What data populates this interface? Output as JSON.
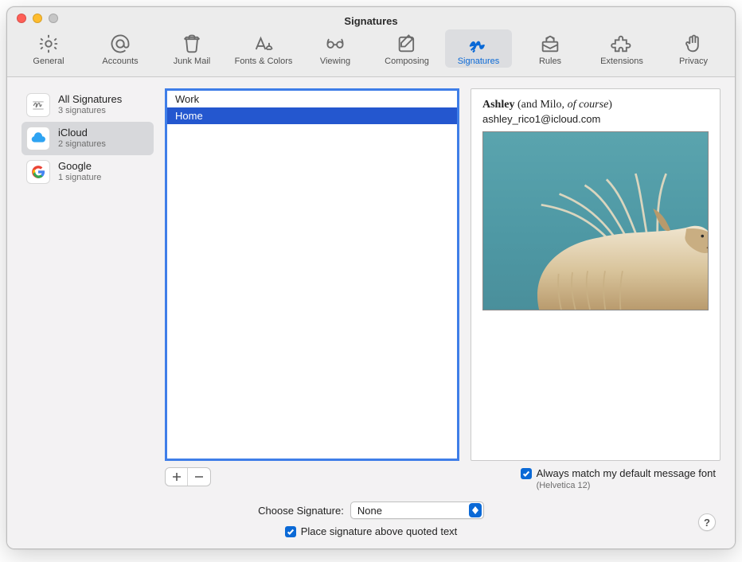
{
  "window_title": "Signatures",
  "toolbar": [
    {
      "id": "general",
      "label": "General"
    },
    {
      "id": "accounts",
      "label": "Accounts"
    },
    {
      "id": "junkmail",
      "label": "Junk Mail"
    },
    {
      "id": "fonts",
      "label": "Fonts & Colors"
    },
    {
      "id": "viewing",
      "label": "Viewing"
    },
    {
      "id": "composing",
      "label": "Composing"
    },
    {
      "id": "signatures",
      "label": "Signatures"
    },
    {
      "id": "rules",
      "label": "Rules"
    },
    {
      "id": "extensions",
      "label": "Extensions"
    },
    {
      "id": "privacy",
      "label": "Privacy"
    }
  ],
  "selected_toolbar": "signatures",
  "accounts": [
    {
      "id": "all",
      "name": "All Signatures",
      "count": "3 signatures"
    },
    {
      "id": "icloud",
      "name": "iCloud",
      "count": "2 signatures"
    },
    {
      "id": "google",
      "name": "Google",
      "count": "1 signature"
    }
  ],
  "selected_account": "icloud",
  "signatures": [
    "Work",
    "Home"
  ],
  "selected_signature": "Home",
  "preview": {
    "name_bold": "Ashley",
    "name_rest": " (and Milo, ",
    "name_italic": "of course",
    "name_tail": ")",
    "email": "ashley_rico1@icloud.com"
  },
  "match_font_label": "Always match my default message font",
  "match_font_sub": "(Helvetica 12)",
  "match_font_checked": true,
  "choose_label": "Choose Signature:",
  "choose_value": "None",
  "place_label": "Place signature above quoted text",
  "place_checked": true,
  "help_glyph": "?"
}
